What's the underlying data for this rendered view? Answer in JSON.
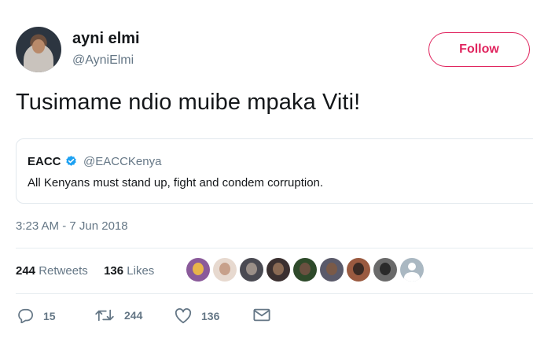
{
  "user": {
    "name": "ayni elmi",
    "handle": "@AyniElmi"
  },
  "follow_label": "Follow",
  "tweet_text": "Tusimame ndio muibe mpaka Viti!",
  "quoted": {
    "name": "EACC",
    "handle": "@EACCKenya",
    "text": "All Kenyans must stand up, fight and condem corruption."
  },
  "timestamp": "3:23 AM - 7 Jun 2018",
  "stats": {
    "retweets_count": "244",
    "retweets_label": "Retweets",
    "likes_count": "136",
    "likes_label": "Likes"
  },
  "likers": [
    {
      "icon": "liker-avatar-1",
      "bg": "#8a5a9a",
      "fg": "#e8b44a"
    },
    {
      "icon": "liker-avatar-2",
      "bg": "#e7d9cf",
      "fg": "#c7a08a"
    },
    {
      "icon": "liker-avatar-3",
      "bg": "#4a4a52",
      "fg": "#9a8f88"
    },
    {
      "icon": "liker-avatar-4",
      "bg": "#3b3030",
      "fg": "#8a6a54"
    },
    {
      "icon": "liker-avatar-5",
      "bg": "#2e4a2a",
      "fg": "#6a5040"
    },
    {
      "icon": "liker-avatar-6",
      "bg": "#5a5a6a",
      "fg": "#7a5a48"
    },
    {
      "icon": "liker-avatar-7",
      "bg": "#9a5a40",
      "fg": "#3a2a24"
    },
    {
      "icon": "liker-avatar-8",
      "bg": "#6a6a6a",
      "fg": "#2a2a2a"
    },
    {
      "icon": "default-avatar",
      "bg": "#aab8c2",
      "fg": "#ffffff"
    }
  ],
  "actions": {
    "replies": "15",
    "retweets": "244",
    "likes": "136"
  },
  "colors": {
    "accent": "#e0245e",
    "verified": "#1da1f2",
    "muted": "#657786"
  }
}
